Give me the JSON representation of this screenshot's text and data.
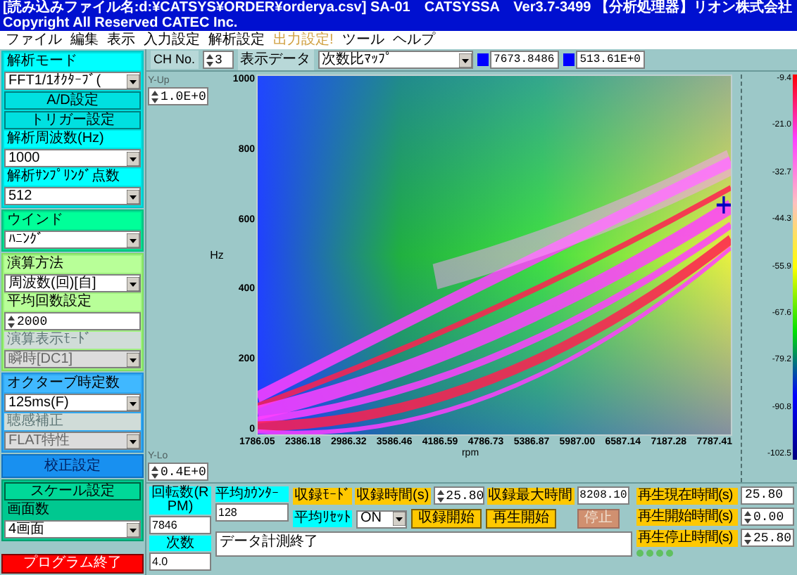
{
  "window": {
    "title": "[読み込みファイル名:d:¥CATSYS¥ORDER¥orderya.csv] SA-01　CATSYSSA　Ver3.7-3499 【分析処理器】リオン株式会社　Copyright All Reserved CATEC Inc."
  },
  "menu": [
    {
      "label": "ファイル",
      "disabled": false
    },
    {
      "label": "編集",
      "disabled": false
    },
    {
      "label": "表示",
      "disabled": false
    },
    {
      "label": "入力設定",
      "disabled": false
    },
    {
      "label": "解析設定",
      "disabled": false
    },
    {
      "label": "出力設定!",
      "disabled": true
    },
    {
      "label": "ツール",
      "disabled": false
    },
    {
      "label": "ヘルプ",
      "disabled": false
    }
  ],
  "left_panel": [
    {
      "kind": "analysis",
      "items": [
        {
          "kind": "label",
          "text": "解析モード",
          "disabled": false
        },
        {
          "kind": "select",
          "value": "FFT1/1ｵｸﾀｰﾌﾞ(",
          "disabled": false
        },
        {
          "kind": "button",
          "text": "A/D設定"
        },
        {
          "kind": "button",
          "text": "トリガー設定"
        },
        {
          "kind": "label",
          "text": "解析周波数(Hz)",
          "disabled": false
        },
        {
          "kind": "select",
          "value": "1000",
          "disabled": false
        },
        {
          "kind": "label",
          "text": "解析ｻﾝﾌﾟﾘﾝｸﾞ点数",
          "disabled": false
        },
        {
          "kind": "select",
          "value": "512",
          "disabled": false
        }
      ]
    },
    {
      "kind": "window",
      "items": [
        {
          "kind": "label",
          "text": "ウインド",
          "disabled": false
        },
        {
          "kind": "select",
          "value": "ﾊﾆﾝｸﾞ",
          "disabled": false
        }
      ]
    },
    {
      "kind": "calc",
      "items": [
        {
          "kind": "label",
          "text": "演算方法",
          "disabled": false
        },
        {
          "kind": "select",
          "value": "周波数(回)[自]",
          "disabled": false
        },
        {
          "kind": "label",
          "text": "平均回数設定",
          "disabled": false
        },
        {
          "kind": "spinner",
          "value": "2000"
        },
        {
          "kind": "label",
          "text": "演算表示ﾓｰﾄﾞ",
          "disabled": true
        },
        {
          "kind": "select",
          "value": "瞬時[DC1]",
          "disabled": true
        }
      ]
    },
    {
      "kind": "octave",
      "items": [
        {
          "kind": "label",
          "text": "オクターブ時定数",
          "disabled": false
        },
        {
          "kind": "select",
          "value": "125ms(F)",
          "disabled": false
        },
        {
          "kind": "label",
          "text": "聴感補正",
          "disabled": true
        },
        {
          "kind": "select",
          "value": "FLAT特性",
          "disabled": true
        }
      ]
    },
    {
      "kind": "calibration",
      "items": [
        {
          "kind": "button",
          "text": "校正設定"
        }
      ]
    },
    {
      "kind": "scale",
      "items": [
        {
          "kind": "button",
          "text": "スケール設定"
        },
        {
          "kind": "label",
          "text": "画面数",
          "disabled": false
        },
        {
          "kind": "select",
          "value": "4画面",
          "disabled": false
        }
      ]
    }
  ],
  "exit_button": "プログラム終了",
  "toolbar": {
    "channel_label": "CH No.",
    "channel": "3",
    "data_label": "表示データ",
    "data": "次数比ﾏｯﾌﾟ",
    "readouts": [
      "7673.8486",
      "513.61E+0"
    ]
  },
  "plot": {
    "y_up_label": "Y-Up",
    "y_up": "1.0E+0",
    "y_lo_label": "Y-Lo",
    "y_lo": "0.4E+0",
    "ylabel": "Hz",
    "yticks": [
      "1000",
      "800",
      "600",
      "400",
      "200",
      "0"
    ],
    "xlabel": "rpm",
    "xticks": [
      "1786.05",
      "2386.18",
      "2986.32",
      "3586.46",
      "4186.59",
      "4786.73",
      "5386.87",
      "5987.00",
      "6587.14",
      "7187.28",
      "7787.41"
    ],
    "scale_ticks": [
      "-9.4",
      "-21.0",
      "-32.7",
      "-44.3",
      "-55.9",
      "-67.6",
      "-79.2",
      "-90.8",
      "-102.5"
    ]
  },
  "bottom": {
    "rpm_label": "回転数(RPM)",
    "rpm": "7846",
    "order_label": "次数",
    "order": "4.0",
    "avg_counter_label": "平均ｶｳﾝﾀｰ",
    "avg_counter": "128",
    "avg_reset_label": "平均ﾘｾｯﾄ",
    "avg_reset": "ON",
    "rec_mode_label": "収録ﾓｰﾄﾞ",
    "rec_time_label": "収録時間(s)",
    "rec_time": "25.80",
    "rec_max_label": "収録最大時間",
    "rec_max": "8208.10",
    "buttons": [
      {
        "label": "収録開始",
        "disabled": false
      },
      {
        "label": "再生開始",
        "disabled": false
      },
      {
        "label": "停止",
        "disabled": true
      }
    ],
    "message": "データ計測終了",
    "play": [
      {
        "label": "再生現在時間(s)",
        "value": "25.80",
        "kind": "field"
      },
      {
        "label": "再生開始時間(s)",
        "value": "0.00",
        "kind": "spinner"
      },
      {
        "label": "再生停止時間(s)",
        "value": "25.80",
        "kind": "spinner"
      }
    ]
  }
}
